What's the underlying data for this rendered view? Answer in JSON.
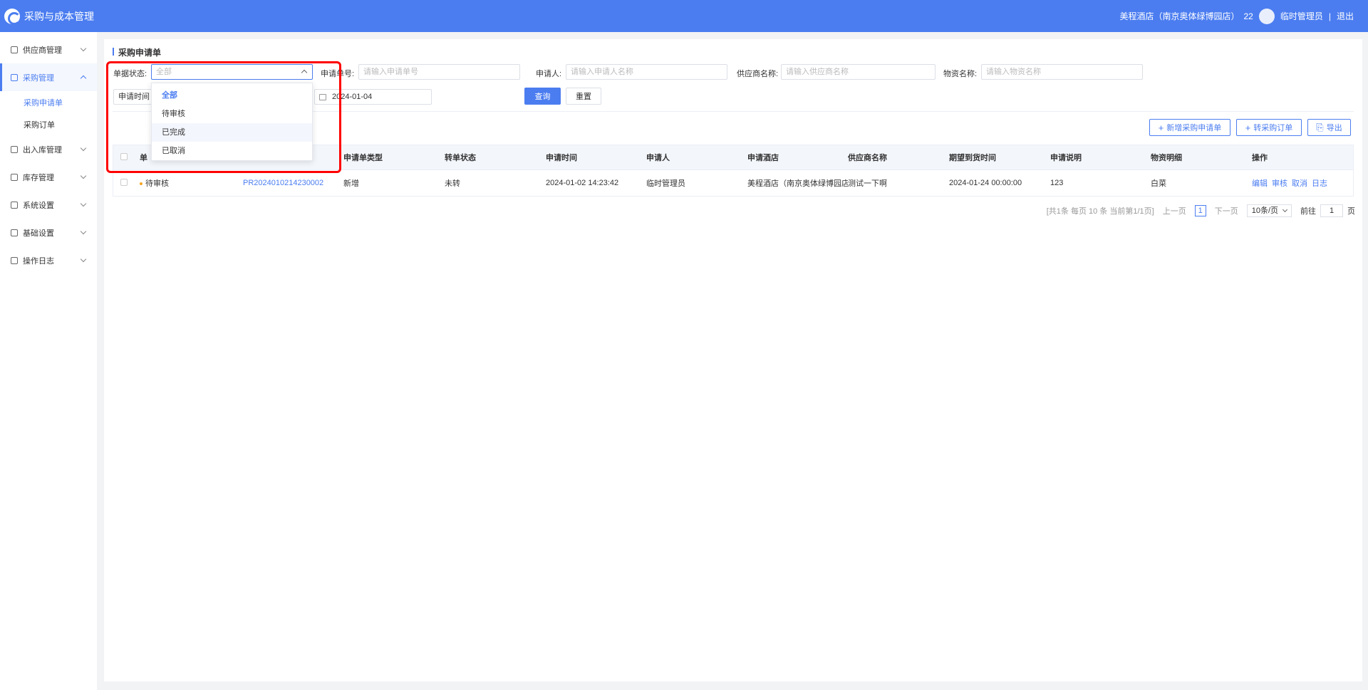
{
  "header": {
    "app_title": "采购与成本管理",
    "hotel": "美程酒店（南京奥体绿博园店）",
    "user_num": "22",
    "username": "临时管理员",
    "separator": "|",
    "logout": "退出"
  },
  "sidebar": {
    "items": [
      {
        "label": "供应商管理"
      },
      {
        "label": "采购管理"
      },
      {
        "label": "出入库管理"
      },
      {
        "label": "库存管理"
      },
      {
        "label": "系统设置"
      },
      {
        "label": "基础设置"
      },
      {
        "label": "操作日志"
      }
    ],
    "sub_items": [
      {
        "label": "采购申请单"
      },
      {
        "label": "采购订单"
      }
    ]
  },
  "page": {
    "title": "采购申请单"
  },
  "filters": {
    "status_label": "单据状态:",
    "status_value": "全部",
    "number_label": "申请单号:",
    "number_placeholder": "请输入申请单号",
    "applicant_label": "申请人:",
    "applicant_placeholder": "请输入申请人名称",
    "supplier_label": "供应商名称:",
    "supplier_placeholder": "请输入供应商名称",
    "material_label": "物资名称:",
    "material_placeholder": "请输入物资名称",
    "time_label": "申请时间",
    "end_date": "2024-01-04",
    "query": "查询",
    "reset": "重置"
  },
  "dropdown": {
    "options": [
      "全部",
      "待审核",
      "已完成",
      "已取消"
    ]
  },
  "toolbar": {
    "add": "新增采购申请单",
    "convert": "转采购订单",
    "export": "导出"
  },
  "table": {
    "headers": [
      "单",
      "",
      "申请单类型",
      "转单状态",
      "申请时间",
      "申请人",
      "申请酒店",
      "供应商名称",
      "期望到货时间",
      "申请说明",
      "物资明细",
      "操作"
    ],
    "rows": [
      {
        "status": "待审核",
        "number": "PR2024010214230002",
        "type": "新增",
        "convert_status": "未转",
        "time": "2024-01-02 14:23:42",
        "applicant": "临时管理员",
        "hotel": "美程酒店（南京奥体绿博园店）",
        "supplier": "测试一下啊",
        "expected": "2024-01-24 00:00:00",
        "note": "123",
        "detail": "白菜",
        "ops": [
          "编辑",
          "审核",
          "取消",
          "日志"
        ]
      }
    ]
  },
  "pagination": {
    "summary": "[共1条 每页 10 条 当前第1/1页]",
    "prev": "上一页",
    "page": "1",
    "next": "下一页",
    "page_size": "10条/页",
    "goto_label": "前往",
    "goto_value": "1",
    "page_suffix": "页"
  },
  "colors": {
    "primary": "#4b7df0",
    "highlight": "#ff0000",
    "pending_dot": "#f5a623"
  }
}
